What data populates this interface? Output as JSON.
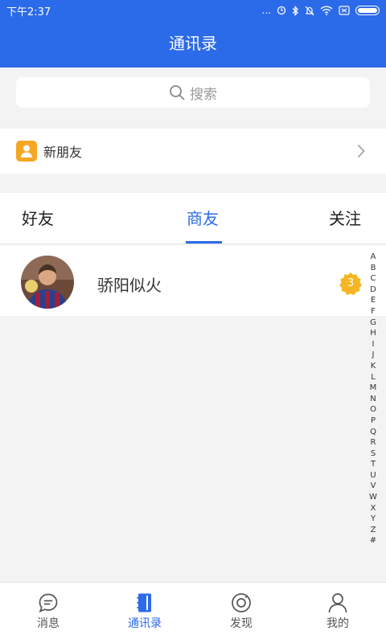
{
  "status_bar": {
    "time": "下午2:37",
    "dots": "..."
  },
  "header": {
    "title": "通讯录"
  },
  "search": {
    "placeholder": "搜索"
  },
  "new_friends": {
    "label": "新朋友"
  },
  "tabs": [
    {
      "label": "好友",
      "active": false
    },
    {
      "label": "商友",
      "active": true
    },
    {
      "label": "关注",
      "active": false
    }
  ],
  "contacts": [
    {
      "name": "骄阳似火",
      "badge": "3"
    }
  ],
  "index_letters": [
    "A",
    "B",
    "C",
    "D",
    "E",
    "F",
    "G",
    "H",
    "I",
    "J",
    "K",
    "L",
    "M",
    "N",
    "O",
    "P",
    "Q",
    "R",
    "S",
    "T",
    "U",
    "V",
    "W",
    "X",
    "Y",
    "Z",
    "#"
  ],
  "bottom_nav": [
    {
      "label": "消息",
      "icon": "chat-icon",
      "active": false
    },
    {
      "label": "通讯录",
      "icon": "contacts-book-icon",
      "active": true
    },
    {
      "label": "发现",
      "icon": "discover-icon",
      "active": false
    },
    {
      "label": "我的",
      "icon": "profile-icon",
      "active": false
    }
  ],
  "colors": {
    "accent": "#2b6ae8",
    "badge": "#f5b623",
    "new_friend_icon": "#f5a623"
  }
}
